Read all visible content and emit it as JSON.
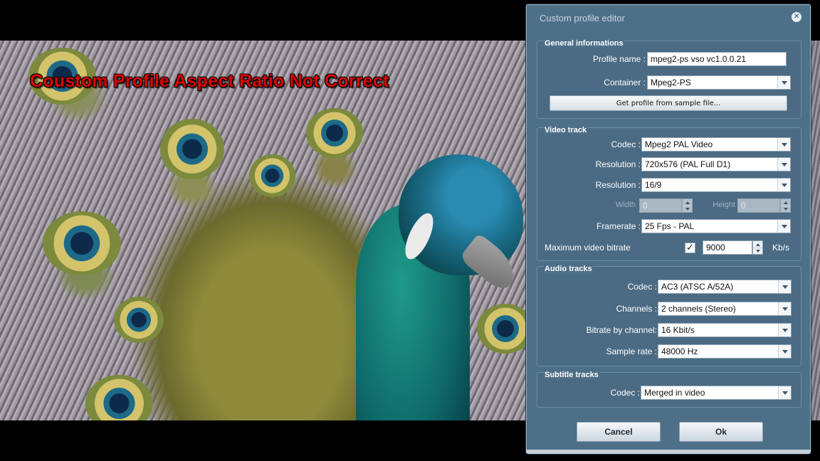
{
  "overlay": {
    "caption": "Coustom Profile Aspect Ratio Not Correct"
  },
  "dialog": {
    "title": "Custom profile editor",
    "close_icon": "close-icon",
    "general": {
      "title": "General informations",
      "profile_name_label": "Profile name :",
      "profile_name_value": "mpeg2-ps vso vc1.0.0.21",
      "container_label": "Container :",
      "container_value": "Mpeg2-PS",
      "sample_button": "Get profile from sample file..."
    },
    "video": {
      "title": "Video track",
      "codec_label": "Codec :",
      "codec_value": "Mpeg2 PAL Video",
      "resolution_label": "Resolution :",
      "resolution_value": "720x576 (PAL Full D1)",
      "aspect_label": "Resolution :",
      "aspect_value": "16/9",
      "width_label": "Width",
      "width_value": "0",
      "height_label": "Height",
      "height_value": "0",
      "framerate_label": "Framerate :",
      "framerate_value": "25 Fps - PAL",
      "bitrate_label": "Maximum video bitrate",
      "bitrate_checked": true,
      "bitrate_check_glyph": "✓",
      "bitrate_value": "9000",
      "bitrate_unit": "Kb/s"
    },
    "audio": {
      "title": "Audio tracks",
      "codec_label": "Codec :",
      "codec_value": "AC3 (ATSC A/52A)",
      "channels_label": "Channels :",
      "channels_value": "2 channels (Stereo)",
      "bitrate_label": "Bitrate by channel:",
      "bitrate_value": "16 Kbit/s",
      "samplerate_label": "Sample rate :",
      "samplerate_value": "48000 Hz"
    },
    "subtitle": {
      "title": "Subtitle tracks",
      "codec_label": "Codec :",
      "codec_value": "Merged in video"
    },
    "buttons": {
      "cancel": "Cancel",
      "ok": "Ok"
    }
  },
  "colors": {
    "dialog_bg": "#4e6f88",
    "caption_red": "#e00000"
  }
}
